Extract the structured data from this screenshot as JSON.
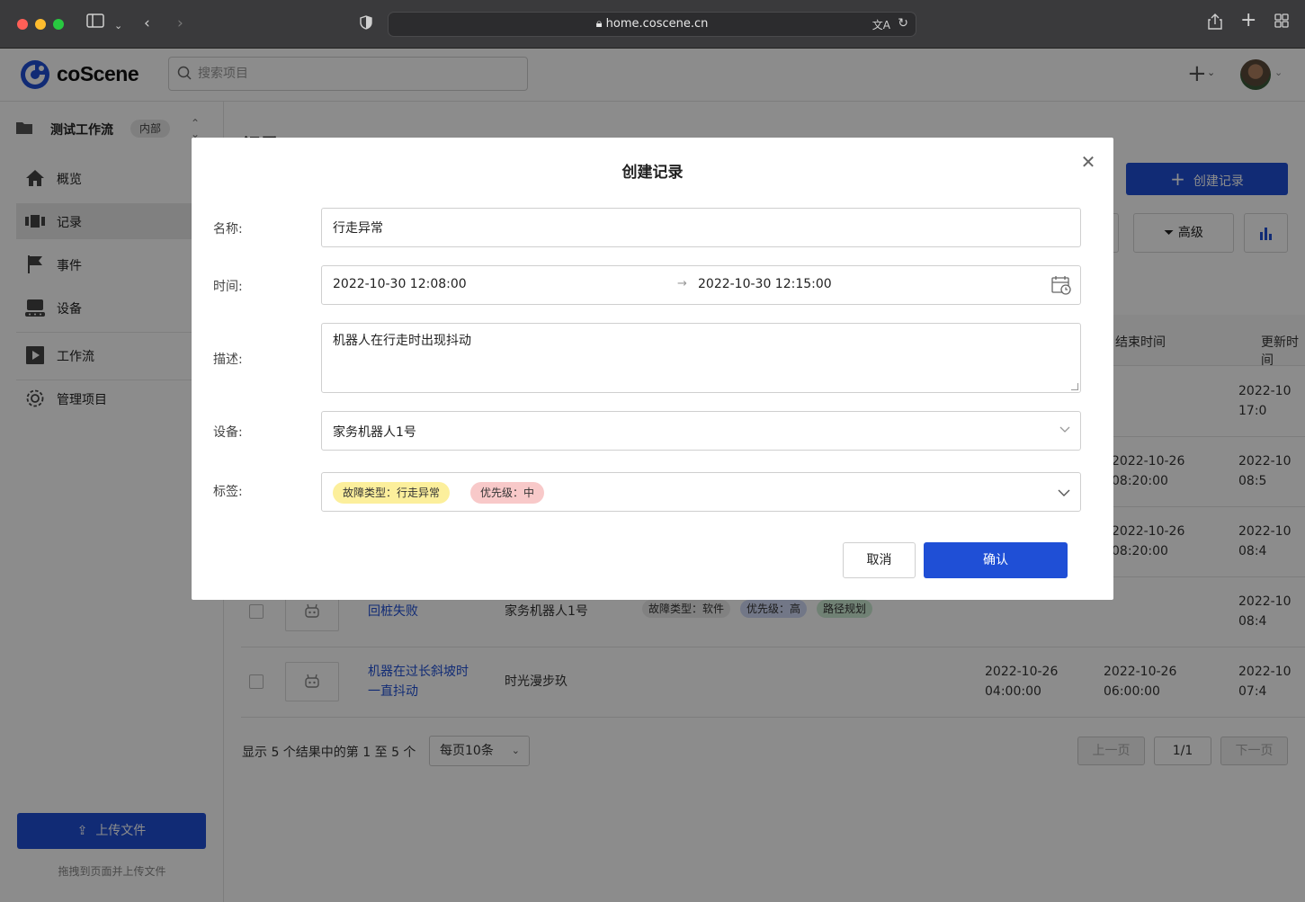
{
  "browser": {
    "url": "home.coscene.cn"
  },
  "app": {
    "brand": "coScene",
    "search_placeholder": "搜索项目"
  },
  "sidebar": {
    "project_name": "测试工作流",
    "project_badge": "内部",
    "items": [
      {
        "label": "概览",
        "icon": "home-icon"
      },
      {
        "label": "记录",
        "icon": "records-icon"
      },
      {
        "label": "事件",
        "icon": "flag-icon"
      },
      {
        "label": "设备",
        "icon": "device-icon"
      },
      {
        "label": "工作流",
        "icon": "play-icon"
      },
      {
        "label": "管理项目",
        "icon": "gear-icon"
      }
    ],
    "upload_label": "上传文件",
    "upload_hint": "拖拽到页面并上传文件"
  },
  "page": {
    "title": "记录",
    "create_button": "创建记录",
    "advanced_button": "高级",
    "col_end_time": "结束时间",
    "col_updated": "更新时间",
    "rows": [
      {
        "updated": "2022-10\n17:0"
      },
      {
        "end": "2022-10-26\n08:20:00",
        "updated": "2022-10\n08:5"
      },
      {
        "end": "2022-10-26\n08:20:00",
        "updated": "2022-10\n08:4"
      },
      {
        "name": "回桩失败",
        "device": "家务机器人1号",
        "tags": [
          "故障类型：软件",
          "优先级：高",
          "路径规划"
        ],
        "updated": "2022-10\n08:4"
      },
      {
        "name": "机器在过长斜坡时\n一直抖动",
        "device": "时光漫步玖",
        "start": "2022-10-26\n04:00:00",
        "end": "2022-10-26\n06:00:00",
        "updated": "2022-10\n07:4"
      }
    ],
    "results_text": "显示 5 个结果中的第 1 至 5 个",
    "page_size": "每页10条",
    "prev": "上一页",
    "page_indicator": "1/1",
    "next": "下一页"
  },
  "modal": {
    "title": "创建记录",
    "name_label": "名称:",
    "name_value": "行走异常",
    "time_label": "时间:",
    "time_start": "2022-10-30 12:08:00",
    "time_arrow": "→",
    "time_end": "2022-10-30 12:15:00",
    "desc_label": "描述:",
    "desc_value": "机器人在行走时出现抖动",
    "device_label": "设备:",
    "device_value": "家务机器人1号",
    "tags_label": "标签:",
    "tags": [
      "故障类型：行走异常",
      "优先级：中"
    ],
    "cancel": "取消",
    "confirm": "确认"
  },
  "colors": {
    "primary": "#1f4fd6",
    "tag_yellow": "#fcef9c",
    "tag_pink": "#f8c9c9"
  }
}
